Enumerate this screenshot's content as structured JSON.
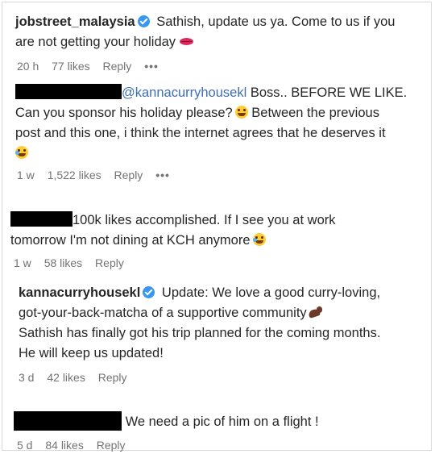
{
  "comments": [
    {
      "username": "jobstreet_malaysia",
      "text": "Sathish, update us ya. Come to us if you",
      "text2": "are not getting your holiday",
      "time": "20 h",
      "likes": "77 likes",
      "reply": "Reply",
      "more": "•••"
    },
    {
      "mention": "@kannacurryhousekl",
      "text": "Boss.. BEFORE WE LIKE.",
      "text2": "Can you sponsor his holiday please?",
      "text2b": "Between the previous",
      "text3": "post and this one, i think the internet agrees that he deserves it",
      "time": "1 w",
      "likes": "1,522 likes",
      "reply": "Reply",
      "more": "•••"
    },
    {
      "text": "100k likes accomplished. If I see you at work",
      "text2": "tomorrow I'm not dining at KCH anymore",
      "time": "1 w",
      "likes": "58 likes",
      "reply": "Reply"
    },
    {
      "username": "kannacurryhousekl",
      "text": "Update: We love a good curry-loving,",
      "text2": "got-your-back-matcha of a supportive community",
      "text3": "Sathish has finally got his trip planned for the coming months.",
      "text4": "He will keep us updated!",
      "time": "3 d",
      "likes": "42 likes",
      "reply": "Reply"
    },
    {
      "text": "We need a pic of him on a flight !",
      "time": "5 d",
      "likes": "84 likes",
      "reply": "Reply"
    }
  ],
  "icons": {
    "verified": "verified-badge-icon",
    "lips": "kiss-lips-emoji",
    "smirk": "smiling-face-emoji",
    "laugh": "tears-of-joy-emoji",
    "flex": "flexed-biceps-emoji"
  },
  "colors": {
    "mention": "#3f6fb5",
    "meta": "#737373",
    "verified": "#3897f0",
    "redaction": "#000000"
  }
}
